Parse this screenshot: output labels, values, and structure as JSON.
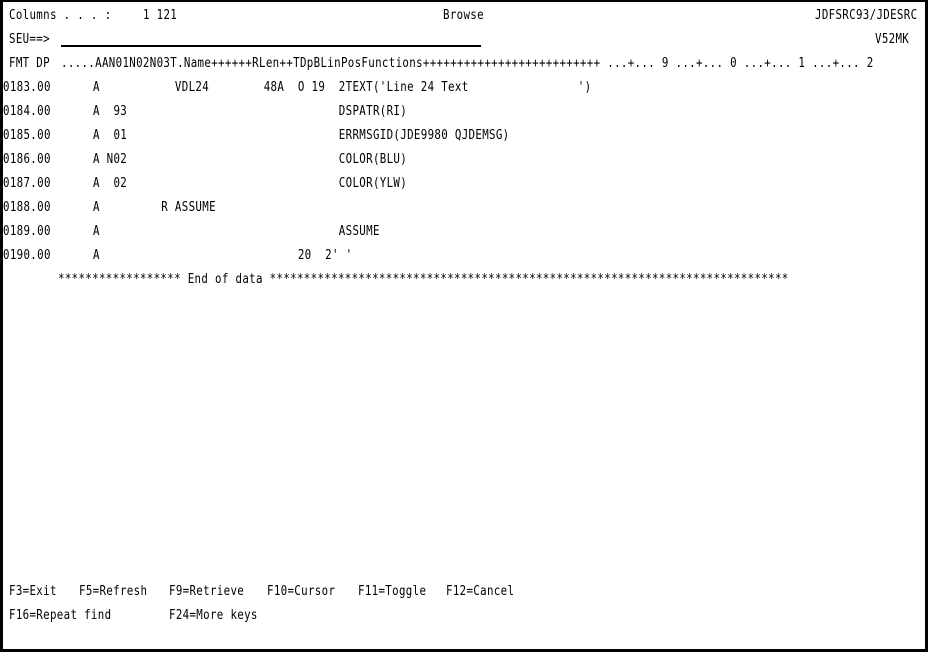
{
  "header": {
    "columns_label": "Columns . . . :",
    "columns_value": "1 121",
    "mode": "Browse",
    "source_file": "JDFSRC93/JDESRC",
    "member": "V52MK",
    "command_prompt": "SEU==>",
    "command_value": "",
    "format_prompt": "FMT DP",
    "ruler": ".....AAN01N02N03T.Name++++++RLen++TDpBLinPosFunctions++++++++++++++++++++++++++ ...+... 9 ...+... 0 ...+... 1 ...+... 2"
  },
  "source_lines": [
    {
      "seq": "0183.00",
      "text": "A           VDL24        48A  O 19  2TEXT('Line 24 Text                ')"
    },
    {
      "seq": "0184.00",
      "text": "A  93                               DSPATR(RI)"
    },
    {
      "seq": "0185.00",
      "text": "A  01                               ERRMSGID(JDE9980 QJDEMSG)"
    },
    {
      "seq": "0186.00",
      "text": "A N02                               COLOR(BLU)"
    },
    {
      "seq": "0187.00",
      "text": "A  02                               COLOR(YLW)"
    },
    {
      "seq": "0188.00",
      "text": "A         R ASSUME"
    },
    {
      "seq": "0189.00",
      "text": "A                                   ASSUME"
    },
    {
      "seq": "0190.00",
      "text": "A                             20  2' '"
    }
  ],
  "end_of_data": "****************** End of data ****************************************************************************",
  "function_keys": [
    {
      "key": "F3",
      "label": "F3=Exit"
    },
    {
      "key": "F5",
      "label": "F5=Refresh"
    },
    {
      "key": "F9",
      "label": "F9=Retrieve"
    },
    {
      "key": "F10",
      "label": "F10=Cursor"
    },
    {
      "key": "F11",
      "label": "F11=Toggle"
    },
    {
      "key": "F12",
      "label": "F12=Cancel"
    },
    {
      "key": "F16",
      "label": "F16=Repeat find"
    },
    {
      "key": "F24",
      "label": "F24=More keys"
    }
  ]
}
